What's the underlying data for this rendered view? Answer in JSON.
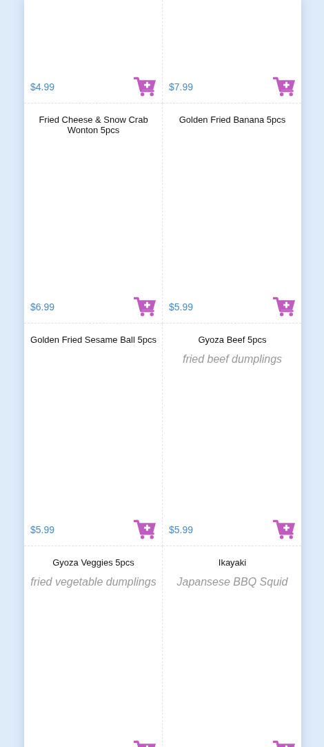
{
  "items": [
    {
      "price": "$4.99"
    },
    {
      "price": "$7.99"
    },
    {
      "name": "Fried Cheese & Snow Crab Wonton 5pcs",
      "price": "$6.99"
    },
    {
      "name": "Golden Fried Banana 5pcs",
      "price": "$5.99"
    },
    {
      "name": "Golden Fried Sesame Ball 5pcs",
      "price": "$5.99"
    },
    {
      "name": "Gyoza Beef 5pcs",
      "description": "fried beef dumplings",
      "price": "$5.99"
    },
    {
      "name": "Gyoza Veggies 5pcs",
      "description": "fried vegetable dumplings"
    },
    {
      "name": "Ikayaki",
      "description": "Japansese BBQ Squid"
    }
  ]
}
